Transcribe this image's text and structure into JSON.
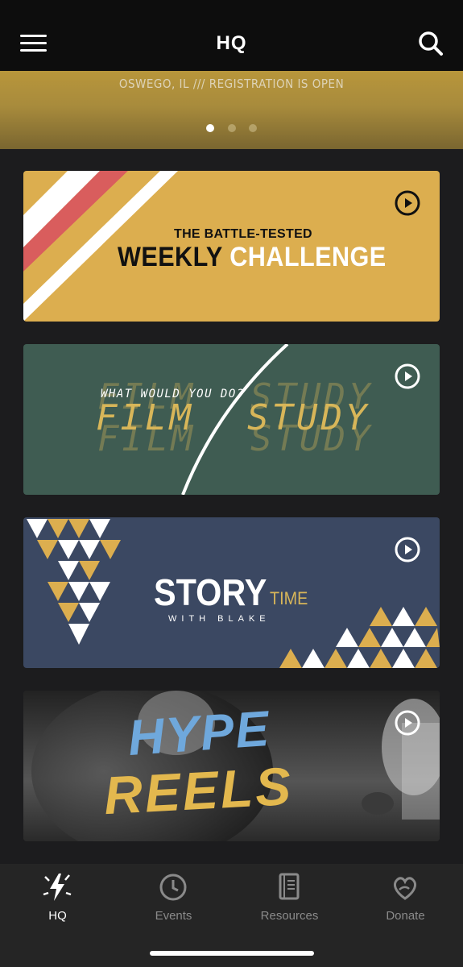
{
  "header": {
    "title": "HQ",
    "menu_icon": "hamburger-menu-icon",
    "search_icon": "search-icon"
  },
  "promo": {
    "text": "OSWEGO, IL /// REGISTRATION IS OPEN",
    "pages": 3,
    "active_page": 1
  },
  "cards": [
    {
      "small": "THE BATTLE-TESTED",
      "big_dark": "WEEKLY",
      "big_light": "CHALLENGE",
      "color": "#dcae4f"
    },
    {
      "question": "WHAT WOULD YOU DO?",
      "left": "FILM",
      "right": "STUDY",
      "color": "#3f5c52"
    },
    {
      "main": "STORY",
      "accent": "TIME",
      "sub": "WITH BLAKE",
      "color": "#3b4862"
    },
    {
      "top": "HYPE",
      "bottom": "REELS",
      "color": "#2b2b2b"
    }
  ],
  "tabs": [
    {
      "label": "HQ",
      "icon": "lightning-star-icon",
      "active": true
    },
    {
      "label": "Events",
      "icon": "clock-icon",
      "active": false
    },
    {
      "label": "Resources",
      "icon": "book-icon",
      "active": false
    },
    {
      "label": "Donate",
      "icon": "heart-hand-icon",
      "active": false
    }
  ],
  "colors": {
    "gold": "#d8b659",
    "accent_red": "#d95d5d",
    "tab_inactive": "#8a8a8a"
  }
}
